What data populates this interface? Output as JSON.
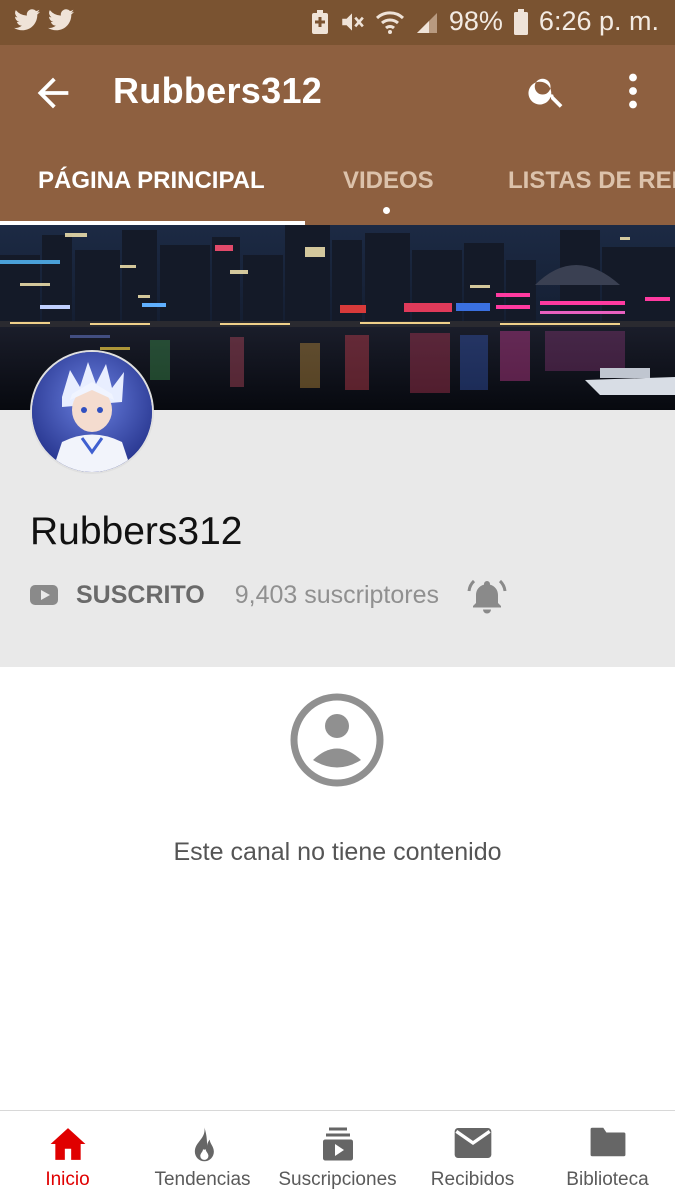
{
  "status_bar": {
    "battery": "98%",
    "time": "6:26 p. m.",
    "icons": [
      "twitter-icon",
      "twitter-icon",
      "battery-saver-icon",
      "mute-icon",
      "wifi-icon",
      "signal-icon",
      "battery-icon"
    ]
  },
  "app_bar": {
    "title": "Rubbers312",
    "icons": [
      "back-arrow-icon",
      "search-icon",
      "more-vert-icon"
    ],
    "tabs": [
      {
        "label": "PÁGINA PRINCIPAL",
        "active": true
      },
      {
        "label": "VIDEOS",
        "active": false
      },
      {
        "label": "LISTAS DE REPRODUCCIÓN",
        "active": false
      }
    ]
  },
  "channel": {
    "name": "Rubbers312",
    "subscribed_label": "SUSCRITO",
    "subscribers": "9,403 suscriptores"
  },
  "empty_state": {
    "message": "Este canal no tiene contenido",
    "icon": "account-circle-icon"
  },
  "bottom_nav": [
    {
      "label": "Inicio",
      "icon": "home-icon",
      "active": true
    },
    {
      "label": "Tendencias",
      "icon": "flame-icon",
      "active": false
    },
    {
      "label": "Suscripciones",
      "icon": "subscriptions-icon",
      "active": false
    },
    {
      "label": "Recibidos",
      "icon": "mail-icon",
      "active": false
    },
    {
      "label": "Biblioteca",
      "icon": "folder-icon",
      "active": false
    }
  ],
  "colors": {
    "status_bar": "#7a5331",
    "app_bar": "#8e6040",
    "active_nav": "#e00000",
    "header_bg": "#e9e9e9"
  }
}
